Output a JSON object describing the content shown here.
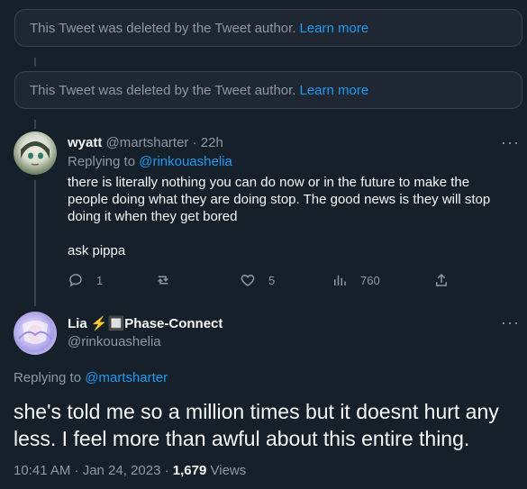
{
  "deleted_tweets": [
    {
      "text": "This Tweet was deleted by the Tweet author.",
      "link": "Learn more"
    },
    {
      "text": "This Tweet was deleted by the Tweet author.",
      "link": "Learn more"
    }
  ],
  "reply_tweet": {
    "name": "wyatt",
    "handle": "@martsharter",
    "separator": "·",
    "time": "22h",
    "replying_prefix": "Replying to",
    "replying_handle": "@rinkouashelia",
    "text_line1": "there is literally nothing you can do now or in the future to make the people doing what they are doing stop. The good news is they will stop doing it when they get bored",
    "text_line2": "ask pippa",
    "actions": {
      "replies": "1",
      "retweets": "",
      "likes": "5",
      "views": "760"
    },
    "more": "···"
  },
  "main_tweet": {
    "name": "Lia ⚡️🔲Phase-Connect",
    "handle": "@rinkouashelia",
    "replying_prefix": "Replying to",
    "replying_handle": "@martsharter",
    "text": "she's told me so a million times but it doesnt hurt any less. I feel more than awful about this entire thing.",
    "timestamp": "10:41 AM · Jan 24, 2023 ·",
    "view_count": "1,679",
    "views_label": "Views",
    "more": "···"
  },
  "colors": {
    "background": "#15202b",
    "accent": "#1d9bf0",
    "muted": "#8b98a5",
    "text": "#f7f9f9"
  }
}
